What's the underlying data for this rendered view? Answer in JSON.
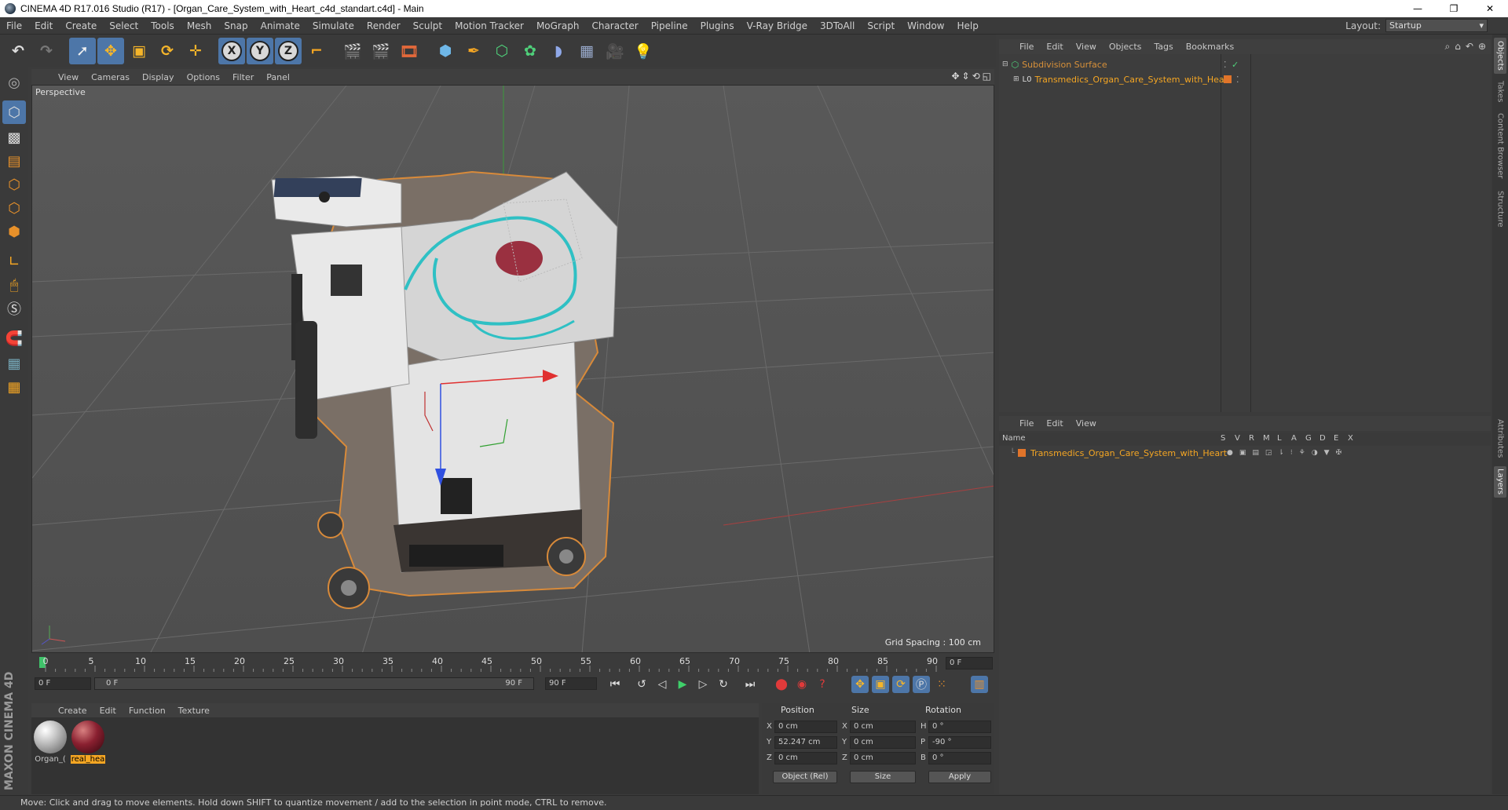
{
  "window": {
    "title": "CINEMA 4D R17.016 Studio (R17) - [Organ_Care_System_with_Heart_c4d_standart.c4d] - Main",
    "min": "—",
    "max": "❐",
    "close": "✕"
  },
  "menubar": {
    "items": [
      "File",
      "Edit",
      "Create",
      "Select",
      "Tools",
      "Mesh",
      "Snap",
      "Animate",
      "Simulate",
      "Render",
      "Sculpt",
      "Motion Tracker",
      "MoGraph",
      "Character",
      "Pipeline",
      "Plugins",
      "V-Ray Bridge",
      "3DToAll",
      "Script",
      "Window",
      "Help"
    ],
    "layout_label": "Layout:",
    "layout_value": "Startup"
  },
  "viewport": {
    "menu": [
      "View",
      "Cameras",
      "Display",
      "Options",
      "Filter",
      "Panel"
    ],
    "camera_label": "Perspective",
    "grid_spacing": "Grid Spacing : 100 cm"
  },
  "timeline": {
    "ticks": [
      "0",
      "5",
      "10",
      "15",
      "20",
      "25",
      "30",
      "35",
      "40",
      "45",
      "50",
      "55",
      "60",
      "65",
      "70",
      "75",
      "80",
      "85",
      "90"
    ],
    "current_frame": "0 F",
    "start_field": "0 F",
    "range_start": "0 F",
    "range_end": "90 F",
    "end_field": "90 F"
  },
  "material_manager": {
    "menu": [
      "Create",
      "Edit",
      "Function",
      "Texture"
    ],
    "materials": [
      {
        "name": "Organ_(",
        "selected": false
      },
      {
        "name": "real_hea",
        "selected": true
      }
    ]
  },
  "coordinates": {
    "headers": {
      "position": "Position",
      "size": "Size",
      "rotation": "Rotation"
    },
    "rows": [
      {
        "axis": "X",
        "pos": "0 cm",
        "size_axis": "X",
        "size": "0 cm",
        "rot_axis": "H",
        "rot": "0 °"
      },
      {
        "axis": "Y",
        "pos": "52.247 cm",
        "size_axis": "Y",
        "size": "0 cm",
        "rot_axis": "P",
        "rot": "-90 °"
      },
      {
        "axis": "Z",
        "pos": "0 cm",
        "size_axis": "Z",
        "size": "0 cm",
        "rot_axis": "B",
        "rot": "0 °"
      }
    ],
    "mode": "Object (Rel)",
    "size_mode": "Size",
    "apply": "Apply"
  },
  "status": "Move: Click and drag to move elements. Hold down SHIFT to quantize movement / add to the selection in point mode, CTRL to remove.",
  "object_manager": {
    "menu": [
      "File",
      "Edit",
      "View",
      "Objects",
      "Tags",
      "Bookmarks"
    ],
    "objects": [
      {
        "name": "Subdivision Surface",
        "level": 0
      },
      {
        "name": "Transmedics_Organ_Care_System_with_Heart",
        "level": 1
      }
    ]
  },
  "layer_manager": {
    "menu": [
      "File",
      "Edit",
      "View"
    ],
    "columns": [
      "Name",
      "S",
      "V",
      "R",
      "M",
      "L",
      "A",
      "G",
      "D",
      "E",
      "X"
    ],
    "layers": [
      {
        "name": "Transmedics_Organ_Care_System_with_Heart",
        "color": "#e0742a"
      }
    ]
  },
  "side_tabs": [
    "Objects",
    "Takes",
    "Content Browser",
    "Structure",
    "Attributes",
    "Layers"
  ],
  "maxon_logo": "MAXON CINEMA 4D",
  "colors": {
    "accent": "#4d76a8",
    "object_orange": "#f5a623",
    "selection_outline": "#e08a30"
  }
}
